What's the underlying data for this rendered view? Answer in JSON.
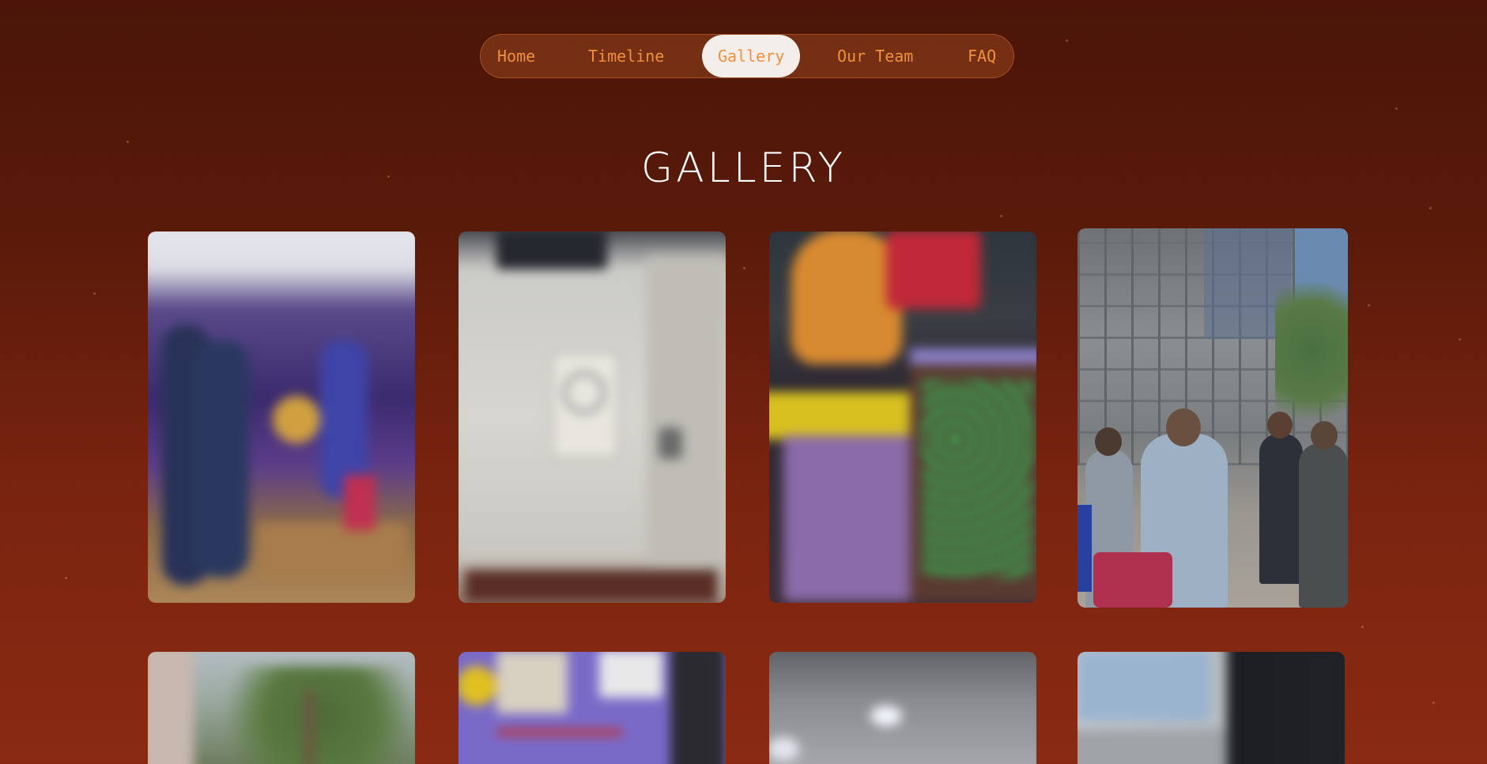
{
  "nav": {
    "items": [
      {
        "label": "Home"
      },
      {
        "label": "Timeline"
      },
      {
        "label": "Gallery"
      },
      {
        "label": "Our Team"
      },
      {
        "label": "FAQ"
      }
    ],
    "active": "Gallery"
  },
  "page": {
    "title": "GALLERY"
  },
  "gallery": {
    "photos": [
      {
        "subject": "award-ceremony-stage",
        "state": "blurred"
      },
      {
        "subject": "white-machine-cabinet",
        "state": "blurred"
      },
      {
        "subject": "project-model-with-circuit-board",
        "state": "blurred"
      },
      {
        "subject": "group-outside-building-scaffolding",
        "state": "focused"
      },
      {
        "subject": "trees-and-building",
        "state": "blurred"
      },
      {
        "subject": "electronics-on-purple-board",
        "state": "blurred"
      },
      {
        "subject": "ceiling-lights",
        "state": "blurred"
      },
      {
        "subject": "laptop-closeup",
        "state": "blurred"
      }
    ]
  },
  "colors": {
    "background_top": "#4a1508",
    "background_bottom": "#8a2a12",
    "nav_text": "#f0903c",
    "nav_active_bg": "#f4eeea",
    "title": "#ffffff"
  }
}
